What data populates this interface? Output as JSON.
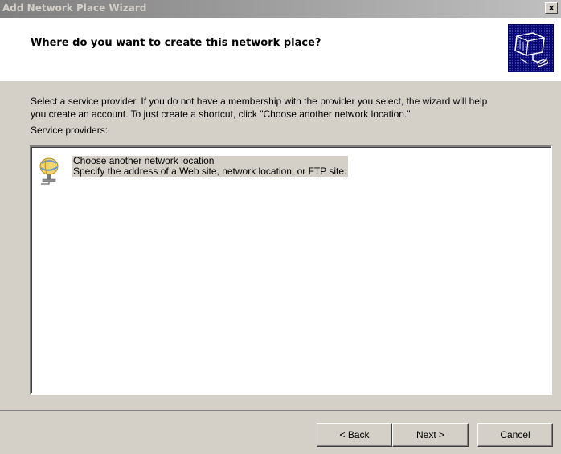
{
  "window": {
    "title": "Add Network Place Wizard",
    "close_label": "x"
  },
  "header": {
    "title": "Where do you want to create this network place?",
    "icon": "network-place-wizard-icon"
  },
  "body": {
    "instructions_line1": "Select a service provider.  If you do not have a membership with the provider you select, the wizard will help",
    "instructions_line2": "you create an account.  To just create a shortcut, click \"Choose another network location.\"",
    "service_providers_label": "Service providers:"
  },
  "providers": [
    {
      "name": "Choose another network location",
      "description": "Specify the address of a Web site, network location, or FTP site.",
      "icon": "network-location-icon",
      "selected": true
    }
  ],
  "buttons": {
    "back": "< Back",
    "next": "Next >",
    "cancel": "Cancel"
  },
  "colors": {
    "dialog_face": "#d4d0c8",
    "inactive_title": "#808080",
    "header_icon_bg": "#0a0a74"
  }
}
